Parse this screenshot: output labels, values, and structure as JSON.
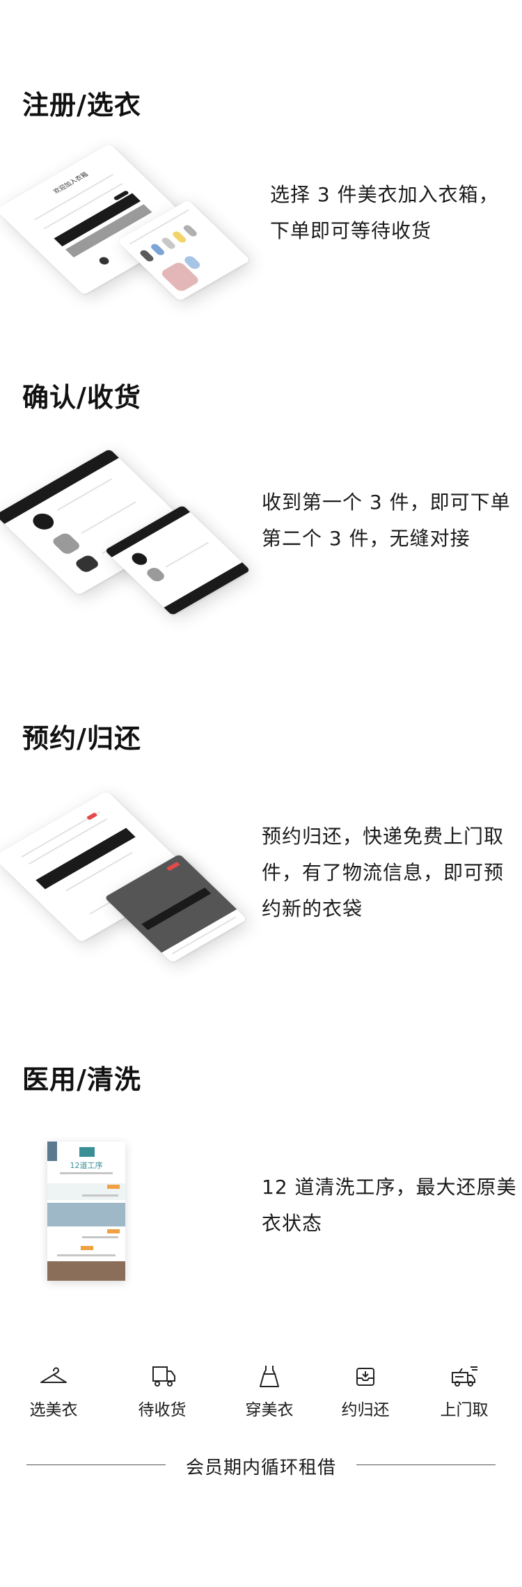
{
  "sections": [
    {
      "title": "注册/选衣",
      "desc_lines": [
        "选择 3 件美衣加入衣箱，",
        "下单即可等待收货"
      ],
      "mock_texts": [
        "欢迎加入衣箱"
      ]
    },
    {
      "title": "确认/收货",
      "desc_lines": [
        "收到第一个 3 件，即可下单",
        "第二个 3 件，无缝对接"
      ]
    },
    {
      "title": "预约/归还",
      "desc_lines": [
        "预约归还，快递免费上门取",
        "件，有了物流信息，即可预",
        "约新的衣袋"
      ]
    },
    {
      "title": "医用/清洗",
      "desc_lines": [
        "12 道清洗工序，最大还原美",
        "衣状态"
      ],
      "poster_title": "12道工序"
    }
  ],
  "icons": [
    {
      "name": "hanger-icon",
      "label": "选美衣"
    },
    {
      "name": "delivery-truck-icon",
      "label": "待收货"
    },
    {
      "name": "dress-icon",
      "label": "穿美衣"
    },
    {
      "name": "return-box-icon",
      "label": "约归还"
    },
    {
      "name": "pickup-truck-icon",
      "label": "上门取"
    }
  ],
  "footer": {
    "text": "会员期内循环租借"
  }
}
